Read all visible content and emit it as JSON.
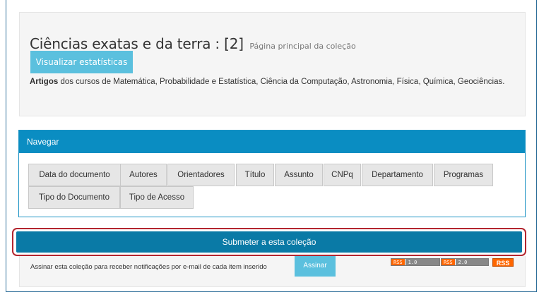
{
  "collection": {
    "title": "Ciências exatas e da terra : [2]",
    "home_link": "Página principal da coleção",
    "stats_button": "Visualizar estatísticas",
    "description_bold": "Artigos",
    "description_rest": " dos cursos de Matemática, Probabilidade e Estatística, Ciência da Computação, Astronomia, Física, Química, Geociências."
  },
  "browse": {
    "heading": "Navegar",
    "buttons": [
      "Data do documento",
      "Autores",
      "Orientadores",
      "Título",
      "Assunto",
      "CNPq",
      "Departamento",
      "Programas",
      "Tipo do Documento",
      "Tipo de Acesso"
    ]
  },
  "submit": {
    "label": "Submeter a esta coleção"
  },
  "subscribe": {
    "text": "Assinar esta coleção para receber notificações por e-mail de cada item inserido",
    "button": "Assinar"
  },
  "feeds": {
    "rss1_left": "RSS",
    "rss1_right": "1.0",
    "rss2_left": "RSS",
    "rss2_right": "2.0",
    "rss_big": "RSS",
    "rss_color": "#ff6600"
  },
  "colors": {
    "panel_heading": "#0a8dc2",
    "submit_bar": "#0a7aa6",
    "info_button": "#5bc0de",
    "highlight_border": "#b3252f"
  }
}
